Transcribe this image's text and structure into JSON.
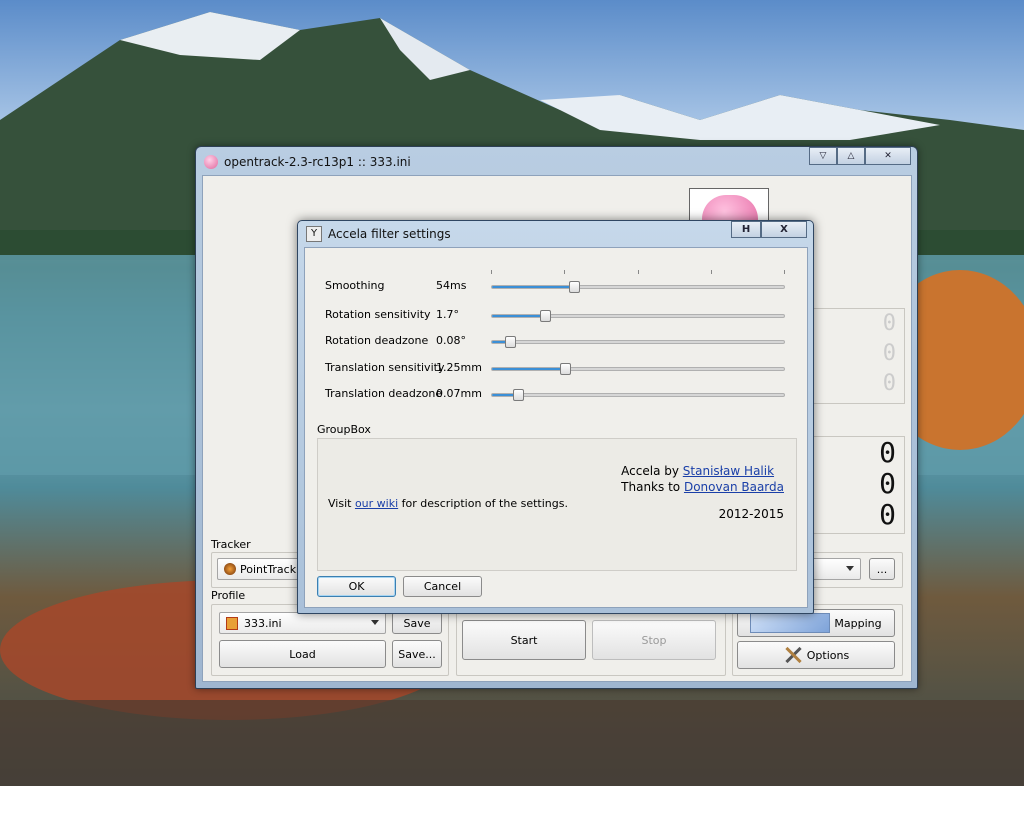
{
  "main_window": {
    "title": "opentrack-2.3-rc13p1 :: 333.ini",
    "caption_buttons": {
      "minimize_icon": "▽",
      "maximize_icon": "△",
      "close_icon": "✕"
    }
  },
  "pose_display": {
    "rotation_readouts": [
      "0",
      "0",
      "0"
    ],
    "translation_readouts": [
      "0",
      "0",
      "0"
    ]
  },
  "tracker": {
    "label": "Tracker",
    "selected": "PointTrack",
    "more_label": "..."
  },
  "profile": {
    "label": "Profile",
    "selected": "333.ini",
    "save_label": "Save",
    "load_label": "Load",
    "save_as_label": "Save..."
  },
  "controls": {
    "start_label": "Start",
    "stop_label": "Stop",
    "mapping_label": "Mapping",
    "options_label": "Options"
  },
  "dialog": {
    "title": "Accela filter settings",
    "caption_buttons": {
      "help_icon": "H",
      "close_icon": "X"
    },
    "sliders": [
      {
        "label": "Smoothing",
        "value": "54ms",
        "fraction": 0.28
      },
      {
        "label": "Rotation sensitivity",
        "value": "1.7°",
        "fraction": 0.18
      },
      {
        "label": "Rotation deadzone",
        "value": "0.08°",
        "fraction": 0.06
      },
      {
        "label": "Translation sensitivity",
        "value": "1.25mm",
        "fraction": 0.25
      },
      {
        "label": "Translation deadzone",
        "value": "0.07mm",
        "fraction": 0.09
      }
    ],
    "group_title": "GroupBox",
    "credits": {
      "accela_by": "Accela by",
      "author": "Stanisław Halik",
      "thanks_to": "Thanks to",
      "contributor": "Donovan Baarda",
      "years": "2012-2015"
    },
    "visit": {
      "prefix": "Visit",
      "link": "our wiki",
      "suffix": "for description of the settings."
    },
    "ok_label": "OK",
    "cancel_label": "Cancel"
  }
}
